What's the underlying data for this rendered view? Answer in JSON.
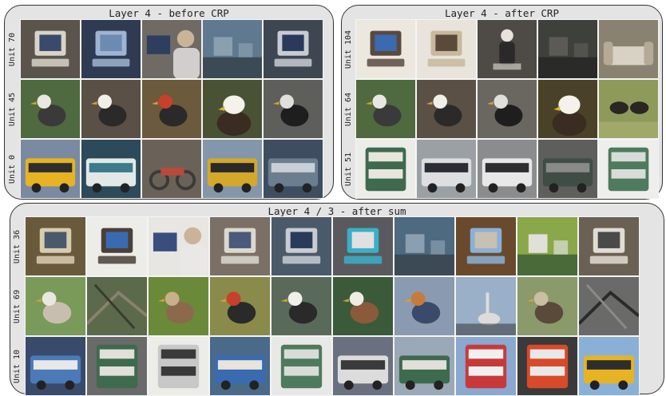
{
  "panels": [
    {
      "id": "before-crp",
      "title": "Layer 4 - before CRP",
      "rows": [
        {
          "label": "Unit 70",
          "thumbs": [
            {
              "subject": "computer",
              "bg": "#5a544c",
              "fg": "#d8d4c8",
              "accent": "#3a4a6a"
            },
            {
              "subject": "computer",
              "bg": "#2e3b52",
              "fg": "#9fb4d0",
              "accent": "#6d8ab0"
            },
            {
              "subject": "person-computer",
              "bg": "#6f6a64",
              "fg": "#c9b49a",
              "accent": "#2d3e5e"
            },
            {
              "subject": "room",
              "bg": "#5f7a90",
              "fg": "#8aa0b0",
              "accent": "#3c4a55"
            },
            {
              "subject": "computer",
              "bg": "#3e4652",
              "fg": "#c8ccd2",
              "accent": "#2a3a5a"
            }
          ]
        },
        {
          "label": "Unit 45",
          "thumbs": [
            {
              "subject": "bird",
              "bg": "#4f6a3e",
              "fg": "#3a3a3a",
              "accent": "#e8e8e0"
            },
            {
              "subject": "bird",
              "bg": "#5a5046",
              "fg": "#2c2a28",
              "accent": "#f0f0ea"
            },
            {
              "subject": "bird",
              "bg": "#6b5a3c",
              "fg": "#2a2a2a",
              "accent": "#c8402c"
            },
            {
              "subject": "eagle",
              "bg": "#4a5236",
              "fg": "#3a2c20",
              "accent": "#f4f2ea"
            },
            {
              "subject": "bird",
              "bg": "#5e5e5a",
              "fg": "#1e1e1e",
              "accent": "#e0e0da"
            }
          ]
        },
        {
          "label": "Unit 0",
          "thumbs": [
            {
              "subject": "bus",
              "bg": "#7a8aa0",
              "fg": "#e6b422",
              "accent": "#2e2e2e"
            },
            {
              "subject": "bus",
              "bg": "#2c4a5a",
              "fg": "#e2e8e8",
              "accent": "#3a7a8a"
            },
            {
              "subject": "motorbike",
              "bg": "#6a6258",
              "fg": "#3c3a38",
              "accent": "#b84a3a"
            },
            {
              "subject": "bus",
              "bg": "#8496aa",
              "fg": "#d4a82a",
              "accent": "#2a2a2a"
            },
            {
              "subject": "bus",
              "bg": "#3e4e60",
              "fg": "#6a7e90",
              "accent": "#c8d0d6"
            }
          ]
        }
      ]
    },
    {
      "id": "after-crp",
      "title": "Layer 4 - after CRP",
      "rows": [
        {
          "label": "Unit 104",
          "thumbs": [
            {
              "subject": "computer",
              "bg": "#ece8e0",
              "fg": "#5a4a3e",
              "accent": "#3a6ab0"
            },
            {
              "subject": "computer",
              "bg": "#e8e4dc",
              "fg": "#c8b89c",
              "accent": "#5a4a3a"
            },
            {
              "subject": "person",
              "bg": "#4e4a46",
              "fg": "#e6e2dc",
              "accent": "#2a2a2a"
            },
            {
              "subject": "room",
              "bg": "#3e403c",
              "fg": "#5c5a54",
              "accent": "#2a2a28"
            },
            {
              "subject": "sofa",
              "bg": "#8a8270",
              "fg": "#d8d2c4",
              "accent": "#b4aa96"
            }
          ]
        },
        {
          "label": "Unit 64",
          "thumbs": [
            {
              "subject": "bird",
              "bg": "#4f6a3e",
              "fg": "#3a3a3a",
              "accent": "#e8e8e0"
            },
            {
              "subject": "bird",
              "bg": "#5a5046",
              "fg": "#2c2a28",
              "accent": "#f0f0ea"
            },
            {
              "subject": "bird",
              "bg": "#6a6660",
              "fg": "#1e1e1e",
              "accent": "#e0e0da"
            },
            {
              "subject": "eagle",
              "bg": "#4a4228",
              "fg": "#3a2c20",
              "accent": "#f4f2ea"
            },
            {
              "subject": "ostrich",
              "bg": "#8e9a5a",
              "fg": "#2a2622",
              "accent": "#e8e4d8"
            }
          ]
        },
        {
          "label": "Unit 51",
          "thumbs": [
            {
              "subject": "doubledecker",
              "bg": "#ecece8",
              "fg": "#3e6a4e",
              "accent": "#e8e6dc"
            },
            {
              "subject": "bus",
              "bg": "#9aa0a4",
              "fg": "#dcdee0",
              "accent": "#2a2e34"
            },
            {
              "subject": "bus",
              "bg": "#8a8c8e",
              "fg": "#e8e8e8",
              "accent": "#2e2e30"
            },
            {
              "subject": "bus",
              "bg": "#5e5e5c",
              "fg": "#3e4e44",
              "accent": "#8a8a88"
            },
            {
              "subject": "doubledecker",
              "bg": "#eeeeec",
              "fg": "#4e7a5e",
              "accent": "#d8dcd8"
            }
          ]
        }
      ]
    },
    {
      "id": "after-sum",
      "title": "Layer 4 / 3 - after sum",
      "rows": [
        {
          "label": "Unit 36",
          "thumbs": [
            {
              "subject": "computer",
              "bg": "#6a5a3c",
              "fg": "#d8ccb0",
              "accent": "#4a5a6a"
            },
            {
              "subject": "computer",
              "bg": "#ecece8",
              "fg": "#4a4038",
              "accent": "#3a6ab0"
            },
            {
              "subject": "person-computer",
              "bg": "#e8e6e2",
              "fg": "#c9b49a",
              "accent": "#3a4e7e"
            },
            {
              "subject": "computer",
              "bg": "#7a7066",
              "fg": "#dcd8d0",
              "accent": "#4a5a7a"
            },
            {
              "subject": "computer",
              "bg": "#4a5a6a",
              "fg": "#c8ccd2",
              "accent": "#2a3a5a"
            },
            {
              "subject": "computer",
              "bg": "#5a5a5e",
              "fg": "#3ab0c8",
              "accent": "#e0e0e0"
            },
            {
              "subject": "room",
              "bg": "#4e6a80",
              "fg": "#8aa0b0",
              "accent": "#3c4a55"
            },
            {
              "subject": "computer",
              "bg": "#6a4a2c",
              "fg": "#8ab0d8",
              "accent": "#c8c0b0"
            },
            {
              "subject": "room",
              "bg": "#8aa84a",
              "fg": "#e0e0d8",
              "accent": "#4a6a3a"
            },
            {
              "subject": "computer",
              "bg": "#6a6054",
              "fg": "#e0dcd4",
              "accent": "#4a4a4a"
            }
          ]
        },
        {
          "label": "Unit 69",
          "thumbs": [
            {
              "subject": "bird",
              "bg": "#7a9a5a",
              "fg": "#c8beb0",
              "accent": "#e8e8e0"
            },
            {
              "subject": "branches",
              "bg": "#5a6a4a",
              "fg": "#8a8070",
              "accent": "#3a3a30"
            },
            {
              "subject": "bird",
              "bg": "#6a8a3a",
              "fg": "#8a6a4a",
              "accent": "#c8b08a"
            },
            {
              "subject": "bird",
              "bg": "#8a8a4a",
              "fg": "#2a2a2a",
              "accent": "#c8402c"
            },
            {
              "subject": "penguin",
              "bg": "#5a6a5a",
              "fg": "#2a2a2a",
              "accent": "#f0f0ea"
            },
            {
              "subject": "duck",
              "bg": "#3a5a3a",
              "fg": "#8a5a3a",
              "accent": "#f0ece4"
            },
            {
              "subject": "bird",
              "bg": "#8a9ab0",
              "fg": "#3a4a6a",
              "accent": "#c87a3a"
            },
            {
              "subject": "heron",
              "bg": "#9ab0c8",
              "fg": "#dcdcd8",
              "accent": "#2a2a2a"
            },
            {
              "subject": "duck",
              "bg": "#8a9a6a",
              "fg": "#5a4a3a",
              "accent": "#c8c0a0"
            },
            {
              "subject": "birds-water",
              "bg": "#6a6a68",
              "fg": "#2a2a2a",
              "accent": "#8a8a88"
            }
          ]
        },
        {
          "label": "Unit 10",
          "thumbs": [
            {
              "subject": "bus",
              "bg": "#3a4a6a",
              "fg": "#4a7ab8",
              "accent": "#e8e8e8"
            },
            {
              "subject": "doubledecker",
              "bg": "#6a6a6a",
              "fg": "#3e6a4e",
              "accent": "#e0e0d8"
            },
            {
              "subject": "doubledecker",
              "bg": "#ecece8",
              "fg": "#c8c8c8",
              "accent": "#3a3a3a"
            },
            {
              "subject": "bus",
              "bg": "#4a6a8a",
              "fg": "#3a6ab0",
              "accent": "#e8e4dc"
            },
            {
              "subject": "doubledecker",
              "bg": "#e8e8e6",
              "fg": "#4e7a5e",
              "accent": "#d8dcd8"
            },
            {
              "subject": "bus",
              "bg": "#6a7080",
              "fg": "#dcdcdc",
              "accent": "#3a3a3a"
            },
            {
              "subject": "bus",
              "bg": "#9aa8b8",
              "fg": "#3e6a4e",
              "accent": "#e0e0d8"
            },
            {
              "subject": "doubledecker",
              "bg": "#8aa8d0",
              "fg": "#c83a3a",
              "accent": "#f0f0f0"
            },
            {
              "subject": "doubledecker",
              "bg": "#3a3a3a",
              "fg": "#d84a2a",
              "accent": "#e8e8e8"
            },
            {
              "subject": "bus",
              "bg": "#8ab0d8",
              "fg": "#e6b422",
              "accent": "#2e2e2e"
            }
          ]
        }
      ]
    }
  ]
}
